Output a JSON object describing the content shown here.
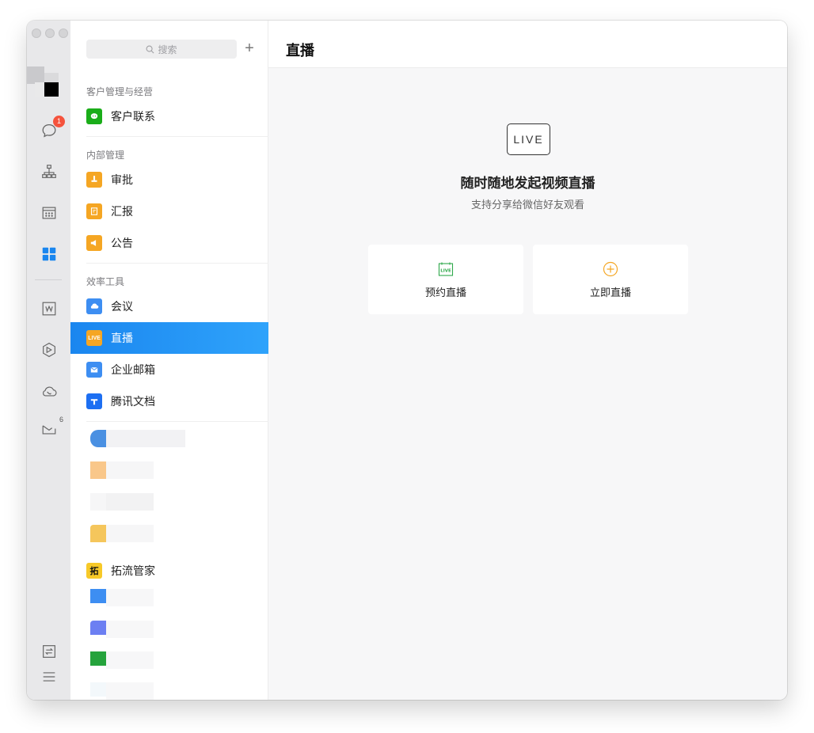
{
  "window": {
    "title": "直播"
  },
  "rail": {
    "messages_badge": "1",
    "mail_count": "6"
  },
  "search": {
    "placeholder": "搜索"
  },
  "add_label": "+",
  "nav": {
    "sections": [
      {
        "title": "客户管理与经营"
      },
      {
        "title": "内部管理"
      },
      {
        "title": "效率工具"
      }
    ],
    "items": [
      {
        "label": "客户联系",
        "icon": "wechat-icon",
        "color": "#1aad19"
      },
      {
        "label": "审批",
        "icon": "approval-icon",
        "color": "#f5a623"
      },
      {
        "label": "汇报",
        "icon": "report-icon",
        "color": "#f5a623"
      },
      {
        "label": "公告",
        "icon": "announcement-icon",
        "color": "#f5a623"
      },
      {
        "label": "会议",
        "icon": "meeting-icon",
        "color": "#3d8ef2"
      },
      {
        "label": "直播",
        "icon": "live-icon",
        "color": "#f5a623",
        "tag": "LIVE"
      },
      {
        "label": "企业邮箱",
        "icon": "mail-icon",
        "color": "#3d8ef2"
      },
      {
        "label": "腾讯文档",
        "icon": "tencent-docs-icon",
        "color": "#1d6ff2"
      },
      {
        "label": "拓流管家",
        "icon": "tuoliu-icon",
        "color": "#f7c928",
        "tag": "拓"
      }
    ]
  },
  "main": {
    "live_label": "LIVE",
    "hero_title": "随时随地发起视频直播",
    "hero_subtitle": "支持分享给微信好友观看",
    "actions": [
      {
        "label": "预约直播",
        "icon": "live-calendar-icon"
      },
      {
        "label": "立即直播",
        "icon": "plus-circle-icon"
      }
    ]
  }
}
